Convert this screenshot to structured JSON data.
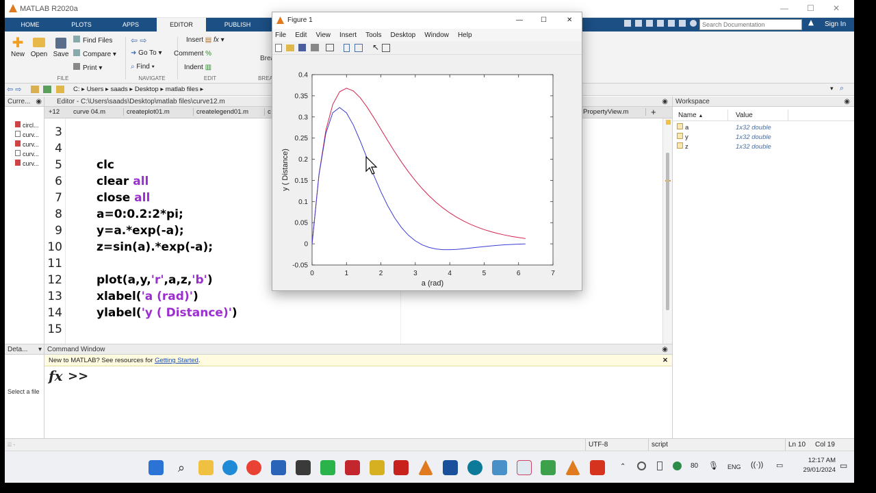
{
  "app": {
    "title": "MATLAB R2020a"
  },
  "tabs": [
    "HOME",
    "PLOTS",
    "APPS",
    "EDITOR",
    "PUBLISH"
  ],
  "ribbon": {
    "new": "New",
    "open": "Open",
    "save": "Save",
    "find_files": "Find Files",
    "compare": "Compare",
    "print": "Print",
    "go_to": "Go To",
    "find": "Find",
    "insert": "Insert",
    "comment": "Comment",
    "indent": "Indent",
    "breakpoints": "Brea",
    "group_file": "FILE",
    "group_navigate": "NAVIGATE",
    "group_edit": "EDIT",
    "group_break": "BREA"
  },
  "search": {
    "placeholder": "Search Documentation"
  },
  "signin": "Sign In",
  "address": {
    "path": [
      "C:",
      "Users",
      "saads",
      "Desktop",
      "matlab files"
    ]
  },
  "current_folder": {
    "title": "Curre...",
    "files": [
      "circl...",
      "curv...",
      "curv...",
      "curv...",
      "curv..."
    ]
  },
  "details": {
    "title": "Deta...",
    "text": "Select a file"
  },
  "editor": {
    "title": "Editor - C:\\Users\\saads\\Desktop\\matlab files\\curve12.m",
    "tabs": [
      "+12",
      "curve 04.m",
      "createplot01.m",
      "createlegend01.m",
      "c",
      "PropertyView.m"
    ],
    "lines": [
      {
        "n": "3",
        "code": ""
      },
      {
        "n": "4",
        "code": ""
      },
      {
        "n": "5",
        "code": "clc"
      },
      {
        "n": "6",
        "pre": "clear ",
        "kw": "all"
      },
      {
        "n": "7",
        "pre": "close ",
        "kw": "all"
      },
      {
        "n": "8",
        "code": "a=0:0.2:2*pi;"
      },
      {
        "n": "9",
        "code": "y=a.*exp(-a);"
      },
      {
        "n": "10",
        "code": "z=sin(a).*exp(-a);"
      },
      {
        "n": "11",
        "code": ""
      },
      {
        "n": "12",
        "pre": "plot(a,y,",
        "kw": "'r'",
        "mid": ",a,z,",
        "kw2": "'b'",
        "post": ")"
      },
      {
        "n": "13",
        "pre": "xlabel(",
        "kw": "'a (rad)'",
        "post": ")"
      },
      {
        "n": "14",
        "pre": "ylabel(",
        "kw": "'y ( Distance)'",
        "post": ")"
      },
      {
        "n": "15",
        "code": ""
      }
    ]
  },
  "command_window": {
    "title": "Command Window",
    "banner": "New to MATLAB? See resources for ",
    "link": "Getting Started",
    "banner_end": ".",
    "prompt": ">>",
    "fx": "fx"
  },
  "workspace": {
    "title": "Workspace",
    "col_name": "Name",
    "col_value": "Value",
    "vars": [
      {
        "name": "a",
        "value": "1x32 double"
      },
      {
        "name": "y",
        "value": "1x32 double"
      },
      {
        "name": "z",
        "value": "1x32 double"
      }
    ]
  },
  "status": {
    "encoding": "UTF-8",
    "type": "script",
    "ln": "Ln  10",
    "col": "Col  19"
  },
  "figure": {
    "title": "Figure 1",
    "menu": [
      "File",
      "Edit",
      "View",
      "Insert",
      "Tools",
      "Desktop",
      "Window",
      "Help"
    ]
  },
  "chart_data": {
    "type": "line",
    "xlabel": "a (rad)",
    "ylabel": "y ( Distance)",
    "xlim": [
      0,
      7
    ],
    "ylim": [
      -0.05,
      0.4
    ],
    "xticks": [
      "0",
      "1",
      "2",
      "3",
      "4",
      "5",
      "6",
      "7"
    ],
    "yticks": [
      "-0.05",
      "0",
      "0.05",
      "0.1",
      "0.15",
      "0.2",
      "0.25",
      "0.3",
      "0.35",
      "0.4"
    ],
    "series": [
      {
        "color": "#d6204b",
        "expr": "a*exp(-a)"
      },
      {
        "color": "#3b3bd6",
        "expr": "sin(a)*exp(-a)"
      }
    ],
    "x_step": 0.2,
    "x_max": 6.2
  },
  "clock": {
    "time": "12:17 AM",
    "date": "29/01/2024"
  },
  "tray": {
    "lang": "ENG",
    "num": "80"
  }
}
